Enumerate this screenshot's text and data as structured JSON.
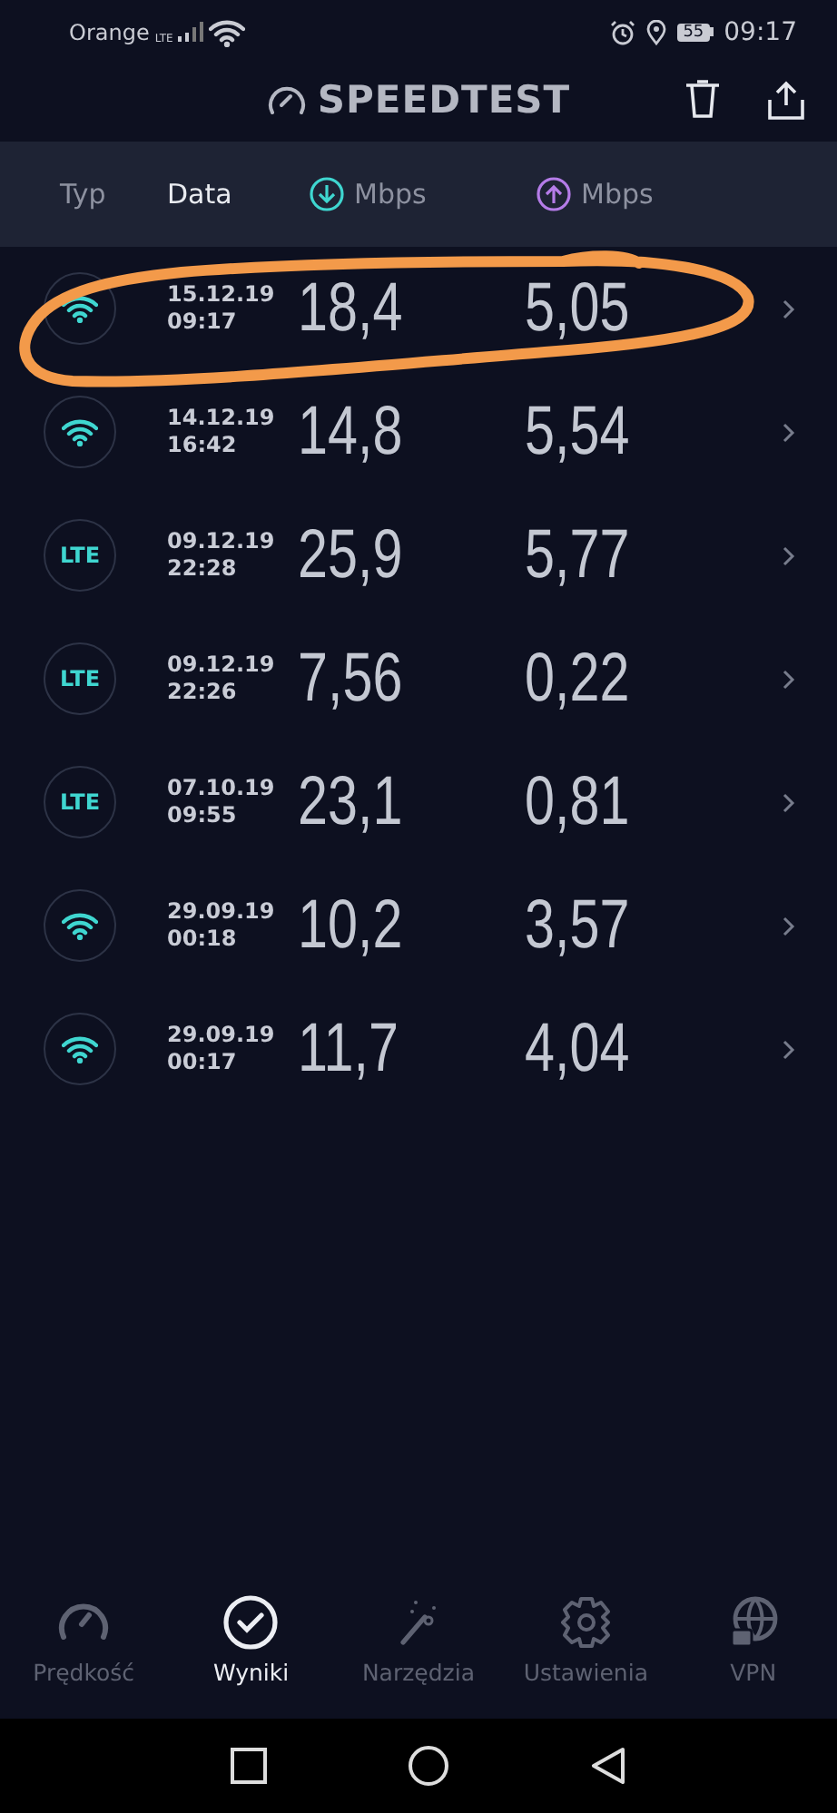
{
  "status_bar": {
    "carrier": "Orange",
    "network": "LTE",
    "battery": "55",
    "time": "09:17"
  },
  "header": {
    "title": "SPEEDTEST"
  },
  "columns": [
    {
      "label": "Typ",
      "kind": "text",
      "selected": false
    },
    {
      "label": "Data",
      "kind": "text",
      "selected": true
    },
    {
      "label": "Mbps",
      "kind": "download",
      "selected": false
    },
    {
      "label": "Mbps",
      "kind": "upload",
      "selected": false
    }
  ],
  "rows": [
    {
      "kind": "wifi",
      "date": "15.12.19",
      "time": "09:17",
      "download": "18,4",
      "upload": "5,05",
      "circled": true
    },
    {
      "kind": "wifi",
      "date": "14.12.19",
      "time": "16:42",
      "download": "14,8",
      "upload": "5,54",
      "circled": false
    },
    {
      "kind": "lte",
      "badge": "LTE",
      "date": "09.12.19",
      "time": "22:28",
      "download": "25,9",
      "upload": "5,77",
      "circled": false
    },
    {
      "kind": "lte",
      "badge": "LTE",
      "date": "09.12.19",
      "time": "22:26",
      "download": "7,56",
      "upload": "0,22",
      "circled": false
    },
    {
      "kind": "lte",
      "badge": "LTE",
      "date": "07.10.19",
      "time": "09:55",
      "download": "23,1",
      "upload": "0,81",
      "circled": false
    },
    {
      "kind": "wifi",
      "date": "29.09.19",
      "time": "00:18",
      "download": "10,2",
      "upload": "3,57",
      "circled": false
    },
    {
      "kind": "wifi",
      "date": "29.09.19",
      "time": "00:17",
      "download": "11,7",
      "upload": "4,04",
      "circled": false
    }
  ],
  "tabs": [
    {
      "label": "Prędkość",
      "kind": "speed",
      "selected": false
    },
    {
      "label": "Wyniki",
      "kind": "results",
      "selected": true
    },
    {
      "label": "Narzędzia",
      "kind": "tools",
      "selected": false
    },
    {
      "label": "Ustawienia",
      "kind": "settings",
      "selected": false
    },
    {
      "label": "VPN",
      "kind": "vpn",
      "selected": false
    }
  ]
}
